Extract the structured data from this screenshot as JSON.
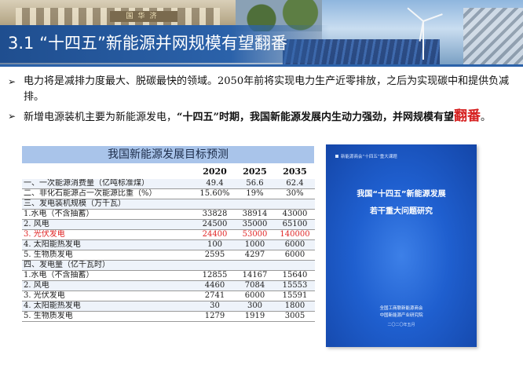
{
  "header": {
    "title": "3.1 “十四五”新能源并网规模有望翻番",
    "sign": "国华济"
  },
  "bullets": [
    {
      "text": "电力将是减排力度最大、脱碳最快的领域。2050年前将实现电力生产近零排放，之后为实现碳中和提供负减排。"
    },
    {
      "pre": "新增电源装机主要为新能源发电，",
      "bold": "“十四五”时期，我国新能源发展内生动力强劲，并网规模有望",
      "highlight": "翻番",
      "post": "。"
    }
  ],
  "table": {
    "title": "我国新能源发展目标预测",
    "columns": [
      "",
      "2020",
      "2025",
      "2035"
    ],
    "rows": [
      {
        "label": "一、一次能源消费量（亿吨标准煤）",
        "v": [
          "49.4",
          "56.6",
          "62.4"
        ]
      },
      {
        "label": "二、非化石能源占一次能源比重（%）",
        "v": [
          "15.60%",
          "19%",
          "30%"
        ]
      },
      {
        "label": "三、发电装机规模（万千瓦）",
        "v": [
          "",
          "",
          ""
        ]
      },
      {
        "label": "  1.水电（不含抽蓄）",
        "v": [
          "33828",
          "38914",
          "43000"
        ]
      },
      {
        "label": "  2. 风电",
        "v": [
          "24500",
          "35000",
          "65100"
        ]
      },
      {
        "label": "  3. 光伏发电",
        "v": [
          "24400",
          "53000",
          "140000"
        ]
      },
      {
        "label": "  4. 太阳能热发电",
        "v": [
          "100",
          "1000",
          "6000"
        ]
      },
      {
        "label": "  5. 生物质发电",
        "v": [
          "2595",
          "4297",
          "6000"
        ]
      },
      {
        "label": "四、发电量（亿千瓦时）",
        "v": [
          "",
          "",
          ""
        ]
      },
      {
        "label": "  1.水电（不含抽蓄）",
        "v": [
          "12855",
          "14167",
          "15640"
        ]
      },
      {
        "label": "  2. 风电",
        "v": [
          "4460",
          "7084",
          "15553"
        ]
      },
      {
        "label": "  3. 光伏发电",
        "v": [
          "2741",
          "6000",
          "15591"
        ]
      },
      {
        "label": "  4. 太阳能热发电",
        "v": [
          "30",
          "300",
          "1800"
        ]
      },
      {
        "label": "  5. 生物质发电",
        "v": [
          "1279",
          "1919",
          "3005"
        ]
      }
    ]
  },
  "cover": {
    "top_label": "新能源商会“十四五”重大课题",
    "title_line1": "我国“十四五”新能源发展",
    "title_line2": "若干重大问题研究",
    "org_line1": "全国工商联新能源商会",
    "org_line2": "中国新能源产业研究院",
    "date": "二〇二〇年五月"
  },
  "colors": {
    "accent": "#2b62aa",
    "highlight": "#d62020",
    "table_header": "#a9c4ea",
    "cover_blue": "#1f5fcf"
  }
}
